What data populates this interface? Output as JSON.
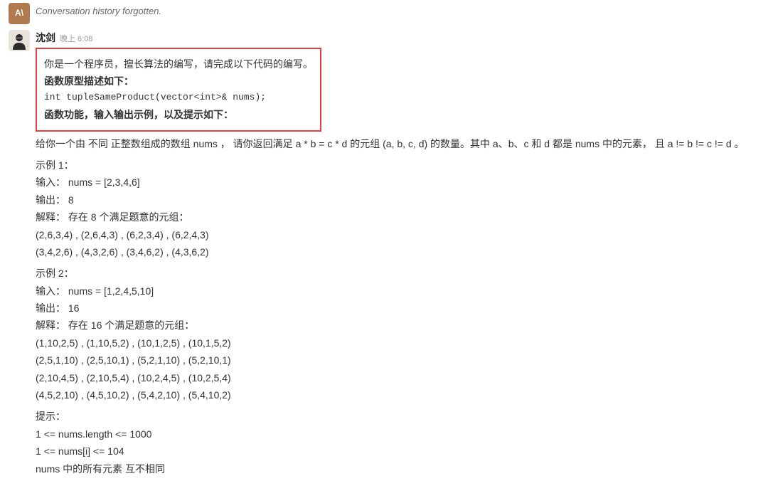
{
  "aiAvatar": "A\\",
  "aiMessage": "Conversation history forgotten.",
  "user": {
    "name": "沈剑",
    "timestamp": "晚上 6:08"
  },
  "highlight": {
    "intro": "你是一个程序员，擅长算法的编写，请完成以下代码的编写。",
    "protoLabel": "函数原型描述如下：",
    "proto": "int tupleSameProduct(vector<int>& nums);",
    "featureLabel": "函数功能，输入输出示例，以及提示如下："
  },
  "problem": "给你一个由 不同 正整数组成的数组 nums ， 请你返回满足 a * b = c * d 的元组 (a, b, c, d) 的数量。其中 a、b、c 和 d 都是 nums 中的元素， 且 a != b != c != d 。",
  "ex1": {
    "title": "示例 1：",
    "input": "输入： nums = [2,3,4,6]",
    "output": "输出： 8",
    "explain": "解释： 存在 8 个满足题意的元组：",
    "row1": "(2,6,3,4) , (2,6,4,3) , (6,2,3,4) , (6,2,4,3)",
    "row2": "(3,4,2,6) , (4,3,2,6) , (3,4,6,2) , (4,3,6,2)"
  },
  "ex2": {
    "title": "示例 2：",
    "input": "输入： nums = [1,2,4,5,10]",
    "output": "输出： 16",
    "explain": "解释： 存在 16 个满足题意的元组：",
    "row1": "(1,10,2,5) , (1,10,5,2) , (10,1,2,5) , (10,1,5,2)",
    "row2": "(2,5,1,10) , (2,5,10,1) , (5,2,1,10) , (5,2,10,1)",
    "row3": "(2,10,4,5) , (2,10,5,4) , (10,2,4,5) , (10,2,5,4)",
    "row4": "(4,5,2,10) , (4,5,10,2) , (5,4,2,10) , (5,4,10,2)"
  },
  "hints": {
    "title": "提示：",
    "c1": "1 <= nums.length <= 1000",
    "c2": "1 <= nums[i] <= 104",
    "c3": "nums 中的所有元素 互不相同"
  }
}
